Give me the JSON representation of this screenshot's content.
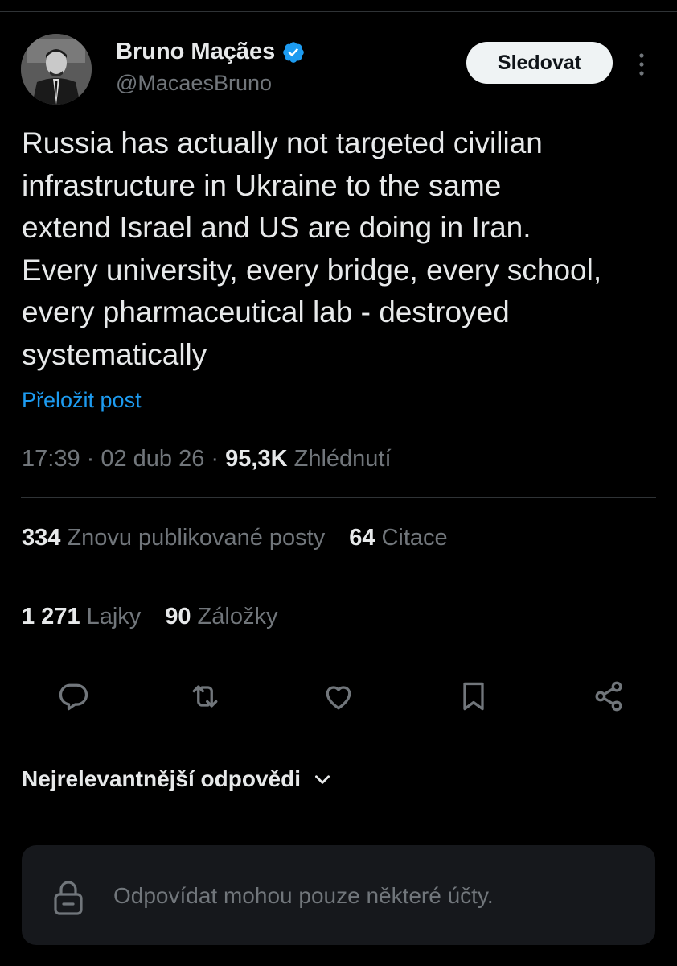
{
  "author": {
    "display_name": "Bruno Maçães",
    "handle": "@MacaesBruno",
    "verified": true,
    "verified_color": "#1d9bf0"
  },
  "follow_button": {
    "label": "Sledovat"
  },
  "tweet": {
    "text": "Russia has actually not targeted civilian\ninfrastructure in Ukraine to the same\nextend Israel and US are doing in Iran.\nEvery university, every bridge, every school,\nevery pharmaceutical lab - destroyed\nsystematically",
    "translate_label": "Přeložit post",
    "time": "17:39",
    "separator": " · ",
    "date": "02 dub 26",
    "views": "95,3K",
    "views_label": "Zhlédnutí"
  },
  "stats": {
    "reposts": {
      "count": "334",
      "label": "Znovu publikované posty"
    },
    "quotes": {
      "count": "64",
      "label": "Citace"
    },
    "likes": {
      "count": "1 271",
      "label": "Lajky"
    },
    "bookmarks": {
      "count": "90",
      "label": "Záložky"
    }
  },
  "actions": [
    "reply-icon",
    "repost-icon",
    "like-icon",
    "bookmark-icon",
    "share-icon"
  ],
  "replies": {
    "sort_label": "Nejrelevantnější odpovědi",
    "restricted_text": "Odpovídat mohou pouze některé účty."
  },
  "colors": {
    "background": "#000000",
    "text_primary": "#e7e9ea",
    "text_secondary": "#71767b",
    "link": "#1d9bf0",
    "divider": "#2f3336",
    "reply_box": "#16181c"
  }
}
